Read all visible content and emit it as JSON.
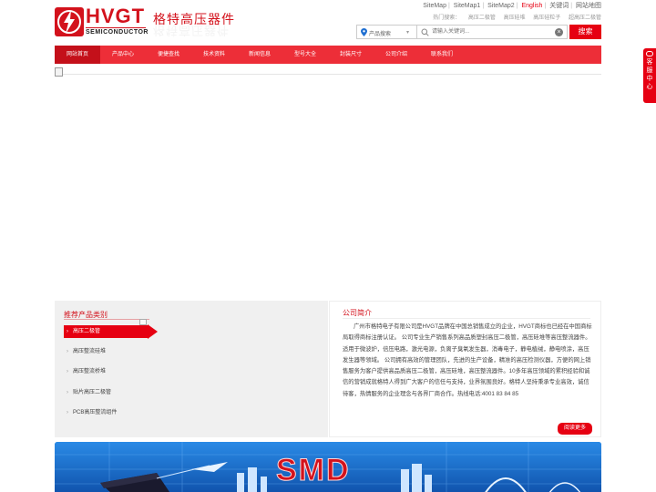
{
  "top_links": {
    "items": [
      "SiteMap",
      "SiteMap1",
      "SiteMap2",
      "English",
      "关键词",
      "网站地图"
    ]
  },
  "hot_search": {
    "label": "热门搜索：",
    "items": [
      "高压二极管",
      "高压硅堆",
      "高压硅粒子",
      "超高压二极管"
    ]
  },
  "logo": {
    "wordmark": "HVGT",
    "subtitle": "SEMICONDUCTOR",
    "brand_name": "格特高压器件"
  },
  "search": {
    "category": "产品搜索",
    "placeholder": "请输入关键词...",
    "button": "搜索"
  },
  "nav": {
    "items": [
      "网站首页",
      "产品中心",
      "便捷查找",
      "技术资料",
      "新闻信息",
      "型号大全",
      "封装尺寸",
      "公司介绍",
      "联系我们"
    ]
  },
  "products": {
    "title": "推荐产品类别",
    "items": [
      "高压二极管",
      "高压整流硅堆",
      "高压整流桥堆",
      "贴片高压二极管",
      "PCB高压整流组件"
    ]
  },
  "company": {
    "title": "公司简介",
    "text": "广州市格特电子有限公司是HVGT品牌在中国总销售成立的企业，HVGT商标也已经在中国商标局取得商标注册认证。 公司专业生产销售系列高品质塑封高压二极管，高压硅堆等高压整流器件。适用于微波炉，倍压电路，激光电源，负离子臭氧发生器，消毒电子，静电植绒，静电喷涂，高压发生器等领域。 公司拥有高效的管理团队，先进的生产设备，精准的高压检测仪器，方便的网上销售服务为客户提供高品质高压二极管，高压硅堆，高压整流器件。10多年高压领域的累积经验和诚信的营销成就格特人得到广大客户的信任与支持，业界氛围良好。格特人坚持秉承专业高效，诚信待客，热情服务的企业理念与各界厂商合作。热线电话:4001 83 84 85",
    "more": "阅读更多"
  },
  "bottom_banner": {
    "text": "SMD"
  },
  "side_tab": {
    "chars": [
      "客",
      "服",
      "中",
      "心"
    ]
  },
  "colors": {
    "brand_red": "#e60012",
    "nav_red": "#ed2e38",
    "nav_active": "#c4101a",
    "banner_blue": "#1b6fcf"
  }
}
